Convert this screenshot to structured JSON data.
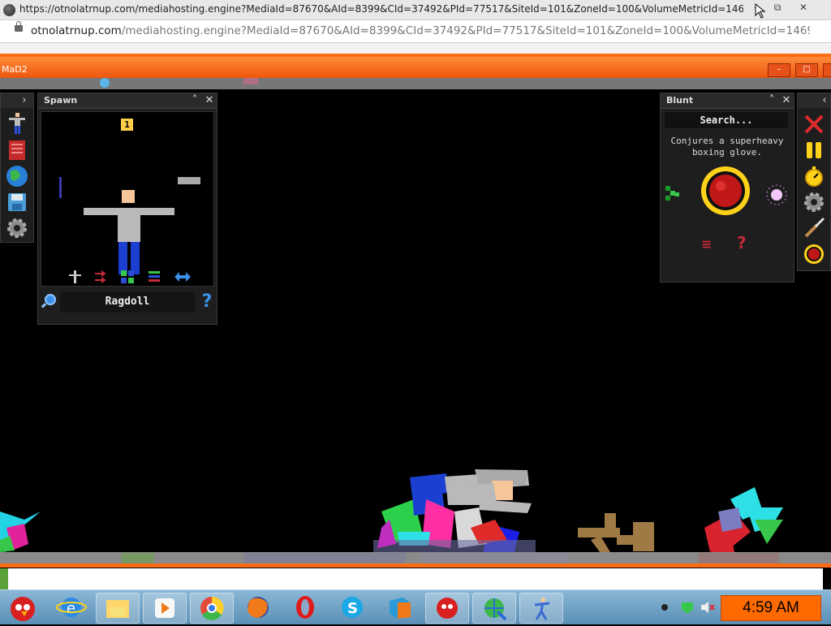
{
  "browser": {
    "title_url": "https://otnolatrnup.com/mediahosting.engine?MediaId=87670&AId=8399&CId=37492&PId=77517&SiteId=101&ZoneId=100&VolumeMetricId=14699881-d2c2-469...",
    "address_url_host": "otnolatrnup.com",
    "address_url_rest": "/mediahosting.engine?MediaId=87670&AId=8399&CId=37492&PId=77517&SiteId=101&ZoneId=100&VolumeMetricId=14699881-d2c...",
    "minimize": "–",
    "restore": "⧉",
    "close": "✕"
  },
  "game": {
    "window_title": "MaD2",
    "spawn_panel": {
      "title": "Spawn",
      "badge": "1",
      "selected_item": "Ragdoll",
      "help": "?"
    },
    "blunt_panel": {
      "title": "Blunt",
      "search_placeholder": "Search...",
      "description_line1": "Conjures a superheavy",
      "description_line2": "boxing glove.",
      "help": "?"
    }
  },
  "taskbar": {
    "clock": "4:59 AM",
    "apps": [
      "angry-birds",
      "internet-explorer",
      "file-explorer",
      "media-player",
      "chrome",
      "firefox",
      "opera",
      "skype",
      "package",
      "angry-birds-2",
      "network-globe",
      "game-ragdoll"
    ]
  },
  "colors": {
    "accent_orange": "#ff6a14",
    "panel_bg": "#1e1e1e",
    "taskbar_blue": "#6c9fc4"
  }
}
